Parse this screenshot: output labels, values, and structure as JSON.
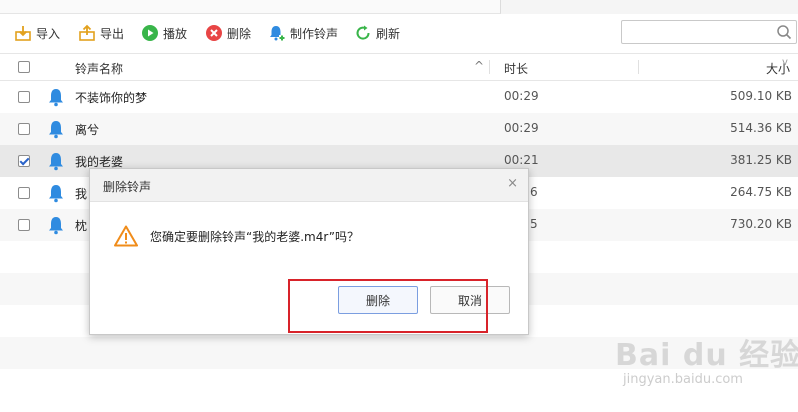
{
  "toolbar": {
    "import_label": "导入",
    "export_label": "导出",
    "play_label": "播放",
    "delete_label": "删除",
    "make_ringtone_label": "制作铃声",
    "refresh_label": "刷新"
  },
  "search": {
    "placeholder": ""
  },
  "table": {
    "headers": {
      "name": "铃声名称",
      "duration": "时长",
      "size": "大小"
    },
    "sort_indicator": "^",
    "size_sort_indicator": "v",
    "rows": [
      {
        "name": "不装饰你的梦",
        "duration": "00:29",
        "size": "509.10 KB",
        "checked": false
      },
      {
        "name": "离兮",
        "duration": "00:29",
        "size": "514.36 KB",
        "checked": false
      },
      {
        "name": "我的老婆",
        "duration": "00:21",
        "size": "381.25 KB",
        "checked": true
      },
      {
        "name": "我",
        "duration": "6",
        "size": "264.75 KB",
        "checked": false
      },
      {
        "name": "枕",
        "duration": "5",
        "size": "730.20 KB",
        "checked": false
      }
    ]
  },
  "dialog": {
    "title": "删除铃声",
    "close_glyph": "×",
    "message": "您确定要删除铃声“我的老婆.m4r”吗？",
    "confirm_label": "删除",
    "cancel_label": "取消"
  },
  "watermark": {
    "brand": "Bai du 经验",
    "url": "jingyan.baidu.com"
  },
  "colors": {
    "accent_blue": "#2f8be0",
    "highlight_red": "#d8232a",
    "selected_row": "#e8e8e8",
    "warning_orange": "#f08c1a"
  }
}
